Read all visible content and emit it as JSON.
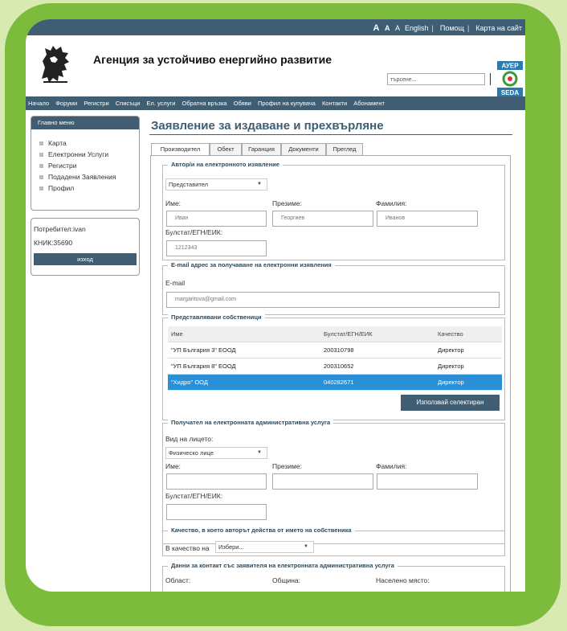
{
  "topbar": {
    "font_sizes": [
      "A",
      "A",
      "A"
    ],
    "language": "English",
    "help": "Помощ",
    "sitemap": "Карта на сайт"
  },
  "header": {
    "agency_title": "Агенция за устойчиво енергийно развитие",
    "search_placeholder": "търсене...",
    "logo_top": "АУЕР",
    "logo_bottom": "SEDA"
  },
  "nav": {
    "items": [
      "Начало",
      "Форуми",
      "Регистри",
      "Списъци",
      "Ел. услуги",
      "Обратна връзка",
      "Обяви",
      "Профил на купувача",
      "Контакти",
      "Абонамент"
    ]
  },
  "sidebar": {
    "menu_title": "Главно меню",
    "items": [
      "Карта",
      "Електронни Услуги",
      "Регистри",
      "Подадени Заявления",
      "Профил"
    ],
    "user_line": "Потребител:ivan",
    "knik_line": "КНИК:35690",
    "logout": "изход"
  },
  "page": {
    "title": "Заявление за издаване и прехвърляне"
  },
  "tabs": [
    "Производител",
    "Обект",
    "Гаранция",
    "Документи",
    "Преглед"
  ],
  "authors": {
    "legend": "Автор/и на електронното изявление",
    "role_select": "Представител",
    "first_name_label": "Име:",
    "middle_name_label": "Презиме:",
    "last_name_label": "Фамилия:",
    "first_name": "Иван",
    "middle_name": "Георгиев",
    "last_name": "Иванов",
    "bulstat_label": "Булстат/ЕГН/ЕИК:",
    "bulstat": "1212343"
  },
  "email": {
    "legend": "E-mail адрес за получаване на електронни изявления",
    "label": "E-mail",
    "value": "margaritova@gmail.com"
  },
  "owners": {
    "legend": "Представлявани собственици",
    "columns": [
      "Име",
      "Булстат/ЕГН/ЕИК",
      "Качество"
    ],
    "rows": [
      [
        "\"УП България 3\" ЕООД",
        "200310798",
        "Директор"
      ],
      [
        "\"УП България 8\" ЕООД",
        "200310652",
        "Директор"
      ],
      [
        "\"Хидро\" ООД",
        "040282671",
        "Директор"
      ]
    ],
    "selected_row": 2,
    "use_selected": "Използвай селектиран"
  },
  "recipient": {
    "legend": "Получател на електронната административна услуга",
    "person_type_label": "Вид на лицето:",
    "person_type": "Физическо лице",
    "first_name_label": "Име:",
    "middle_name_label": "Презиме:",
    "last_name_label": "Фамилия:",
    "bulstat_label": "Булстат/ЕГН/ЕИК:"
  },
  "capacity": {
    "legend": "Качество, в което авторът действа от името на собственика",
    "label": "В качество на",
    "select": "Избери..."
  },
  "contact": {
    "legend": "Данни за контакт със заявителя на електронната административна услуга",
    "region_label": "Област:",
    "municipality_label": "Община:",
    "settlement_label": "Населено място:"
  }
}
